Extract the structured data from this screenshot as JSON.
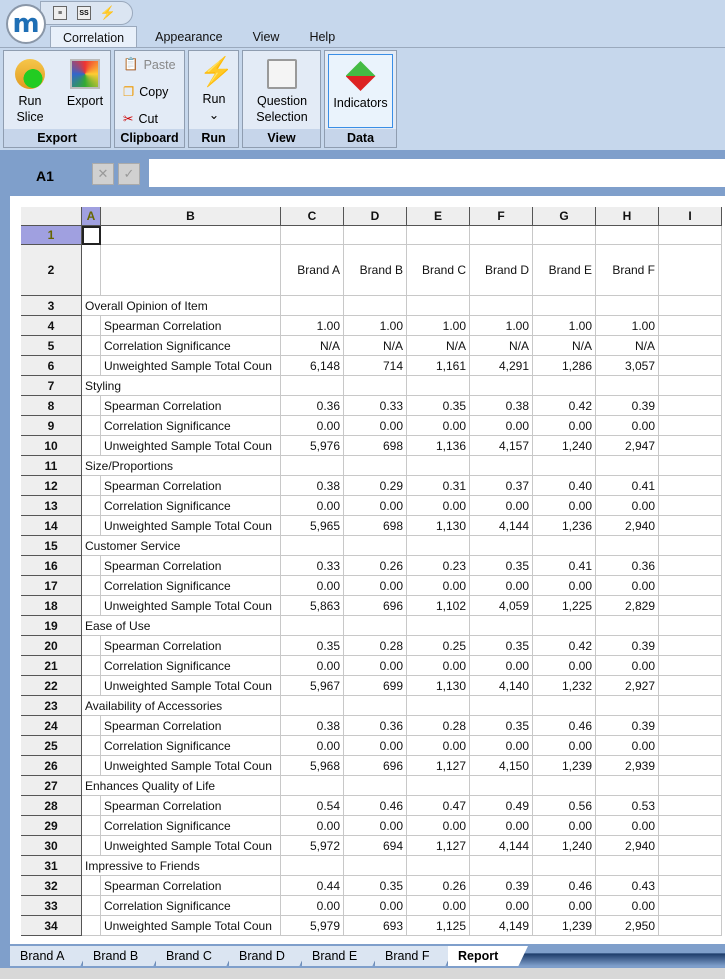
{
  "app": {
    "logo": "m",
    "quick_access": [
      "question-icon",
      "ss-icon",
      "run-icon"
    ]
  },
  "menu_tabs": [
    "Correlation",
    "Appearance",
    "View",
    "Help"
  ],
  "ribbon": {
    "export": {
      "label": "Export",
      "run_slice": "Run\nSlice",
      "export": "Export"
    },
    "clipboard": {
      "label": "Clipboard",
      "paste": "Paste",
      "copy": "Copy",
      "cut": "Cut"
    },
    "run": {
      "label": "Run",
      "run": "Run",
      "chevron": "⌄"
    },
    "view": {
      "label": "View",
      "question_selection": "Question\nSelection"
    },
    "data": {
      "label": "Data",
      "indicators": "Indicators"
    }
  },
  "formula_bar": {
    "cell_ref": "A1",
    "cancel": "✕",
    "confirm": "✓",
    "value": ""
  },
  "columns": [
    "A",
    "B",
    "C",
    "D",
    "E",
    "F",
    "G",
    "H",
    "I"
  ],
  "brands": [
    "Brand A",
    "Brand B",
    "Brand C",
    "Brand D",
    "Brand E",
    "Brand F"
  ],
  "sections": [
    {
      "title": "Overall Opinion of Item",
      "rows": [
        [
          "Spearman Correlation",
          "1.00",
          "1.00",
          "1.00",
          "1.00",
          "1.00",
          "1.00"
        ],
        [
          "Correlation Significance",
          "N/A",
          "N/A",
          "N/A",
          "N/A",
          "N/A",
          "N/A"
        ],
        [
          "Unweighted Sample Total Coun",
          "6,148",
          "714",
          "1,161",
          "4,291",
          "1,286",
          "3,057"
        ]
      ]
    },
    {
      "title": "Styling",
      "rows": [
        [
          "Spearman Correlation",
          "0.36",
          "0.33",
          "0.35",
          "0.38",
          "0.42",
          "0.39"
        ],
        [
          "Correlation Significance",
          "0.00",
          "0.00",
          "0.00",
          "0.00",
          "0.00",
          "0.00"
        ],
        [
          "Unweighted Sample Total Coun",
          "5,976",
          "698",
          "1,136",
          "4,157",
          "1,240",
          "2,947"
        ]
      ]
    },
    {
      "title": "Size/Proportions",
      "rows": [
        [
          "Spearman Correlation",
          "0.38",
          "0.29",
          "0.31",
          "0.37",
          "0.40",
          "0.41"
        ],
        [
          "Correlation Significance",
          "0.00",
          "0.00",
          "0.00",
          "0.00",
          "0.00",
          "0.00"
        ],
        [
          "Unweighted Sample Total Coun",
          "5,965",
          "698",
          "1,130",
          "4,144",
          "1,236",
          "2,940"
        ]
      ]
    },
    {
      "title": "Customer Service",
      "rows": [
        [
          "Spearman Correlation",
          "0.33",
          "0.26",
          "0.23",
          "0.35",
          "0.41",
          "0.36"
        ],
        [
          "Correlation Significance",
          "0.00",
          "0.00",
          "0.00",
          "0.00",
          "0.00",
          "0.00"
        ],
        [
          "Unweighted Sample Total Coun",
          "5,863",
          "696",
          "1,102",
          "4,059",
          "1,225",
          "2,829"
        ]
      ]
    },
    {
      "title": "Ease of Use",
      "rows": [
        [
          "Spearman Correlation",
          "0.35",
          "0.28",
          "0.25",
          "0.35",
          "0.42",
          "0.39"
        ],
        [
          "Correlation Significance",
          "0.00",
          "0.00",
          "0.00",
          "0.00",
          "0.00",
          "0.00"
        ],
        [
          "Unweighted Sample Total Coun",
          "5,967",
          "699",
          "1,130",
          "4,140",
          "1,232",
          "2,927"
        ]
      ]
    },
    {
      "title": "Availability of Accessories",
      "rows": [
        [
          "Spearman Correlation",
          "0.38",
          "0.36",
          "0.28",
          "0.35",
          "0.46",
          "0.39"
        ],
        [
          "Correlation Significance",
          "0.00",
          "0.00",
          "0.00",
          "0.00",
          "0.00",
          "0.00"
        ],
        [
          "Unweighted Sample Total Coun",
          "5,968",
          "696",
          "1,127",
          "4,150",
          "1,239",
          "2,939"
        ]
      ]
    },
    {
      "title": "Enhances Quality of Life",
      "rows": [
        [
          "Spearman Correlation",
          "0.54",
          "0.46",
          "0.47",
          "0.49",
          "0.56",
          "0.53"
        ],
        [
          "Correlation Significance",
          "0.00",
          "0.00",
          "0.00",
          "0.00",
          "0.00",
          "0.00"
        ],
        [
          "Unweighted Sample Total Coun",
          "5,972",
          "694",
          "1,127",
          "4,144",
          "1,240",
          "2,940"
        ]
      ]
    },
    {
      "title": "Impressive to Friends",
      "rows": [
        [
          "Spearman Correlation",
          "0.44",
          "0.35",
          "0.26",
          "0.39",
          "0.46",
          "0.43"
        ],
        [
          "Correlation Significance",
          "0.00",
          "0.00",
          "0.00",
          "0.00",
          "0.00",
          "0.00"
        ],
        [
          "Unweighted Sample Total Coun",
          "5,979",
          "693",
          "1,125",
          "4,149",
          "1,239",
          "2,950"
        ]
      ]
    }
  ],
  "sheet_tabs": [
    "Brand A",
    "Brand B",
    "Brand C",
    "Brand D",
    "Brand E",
    "Brand F",
    "Report"
  ],
  "active_sheet": "Report",
  "colors": {
    "accent": "#7f9fcb",
    "selected_header": "#a0a0e0"
  }
}
